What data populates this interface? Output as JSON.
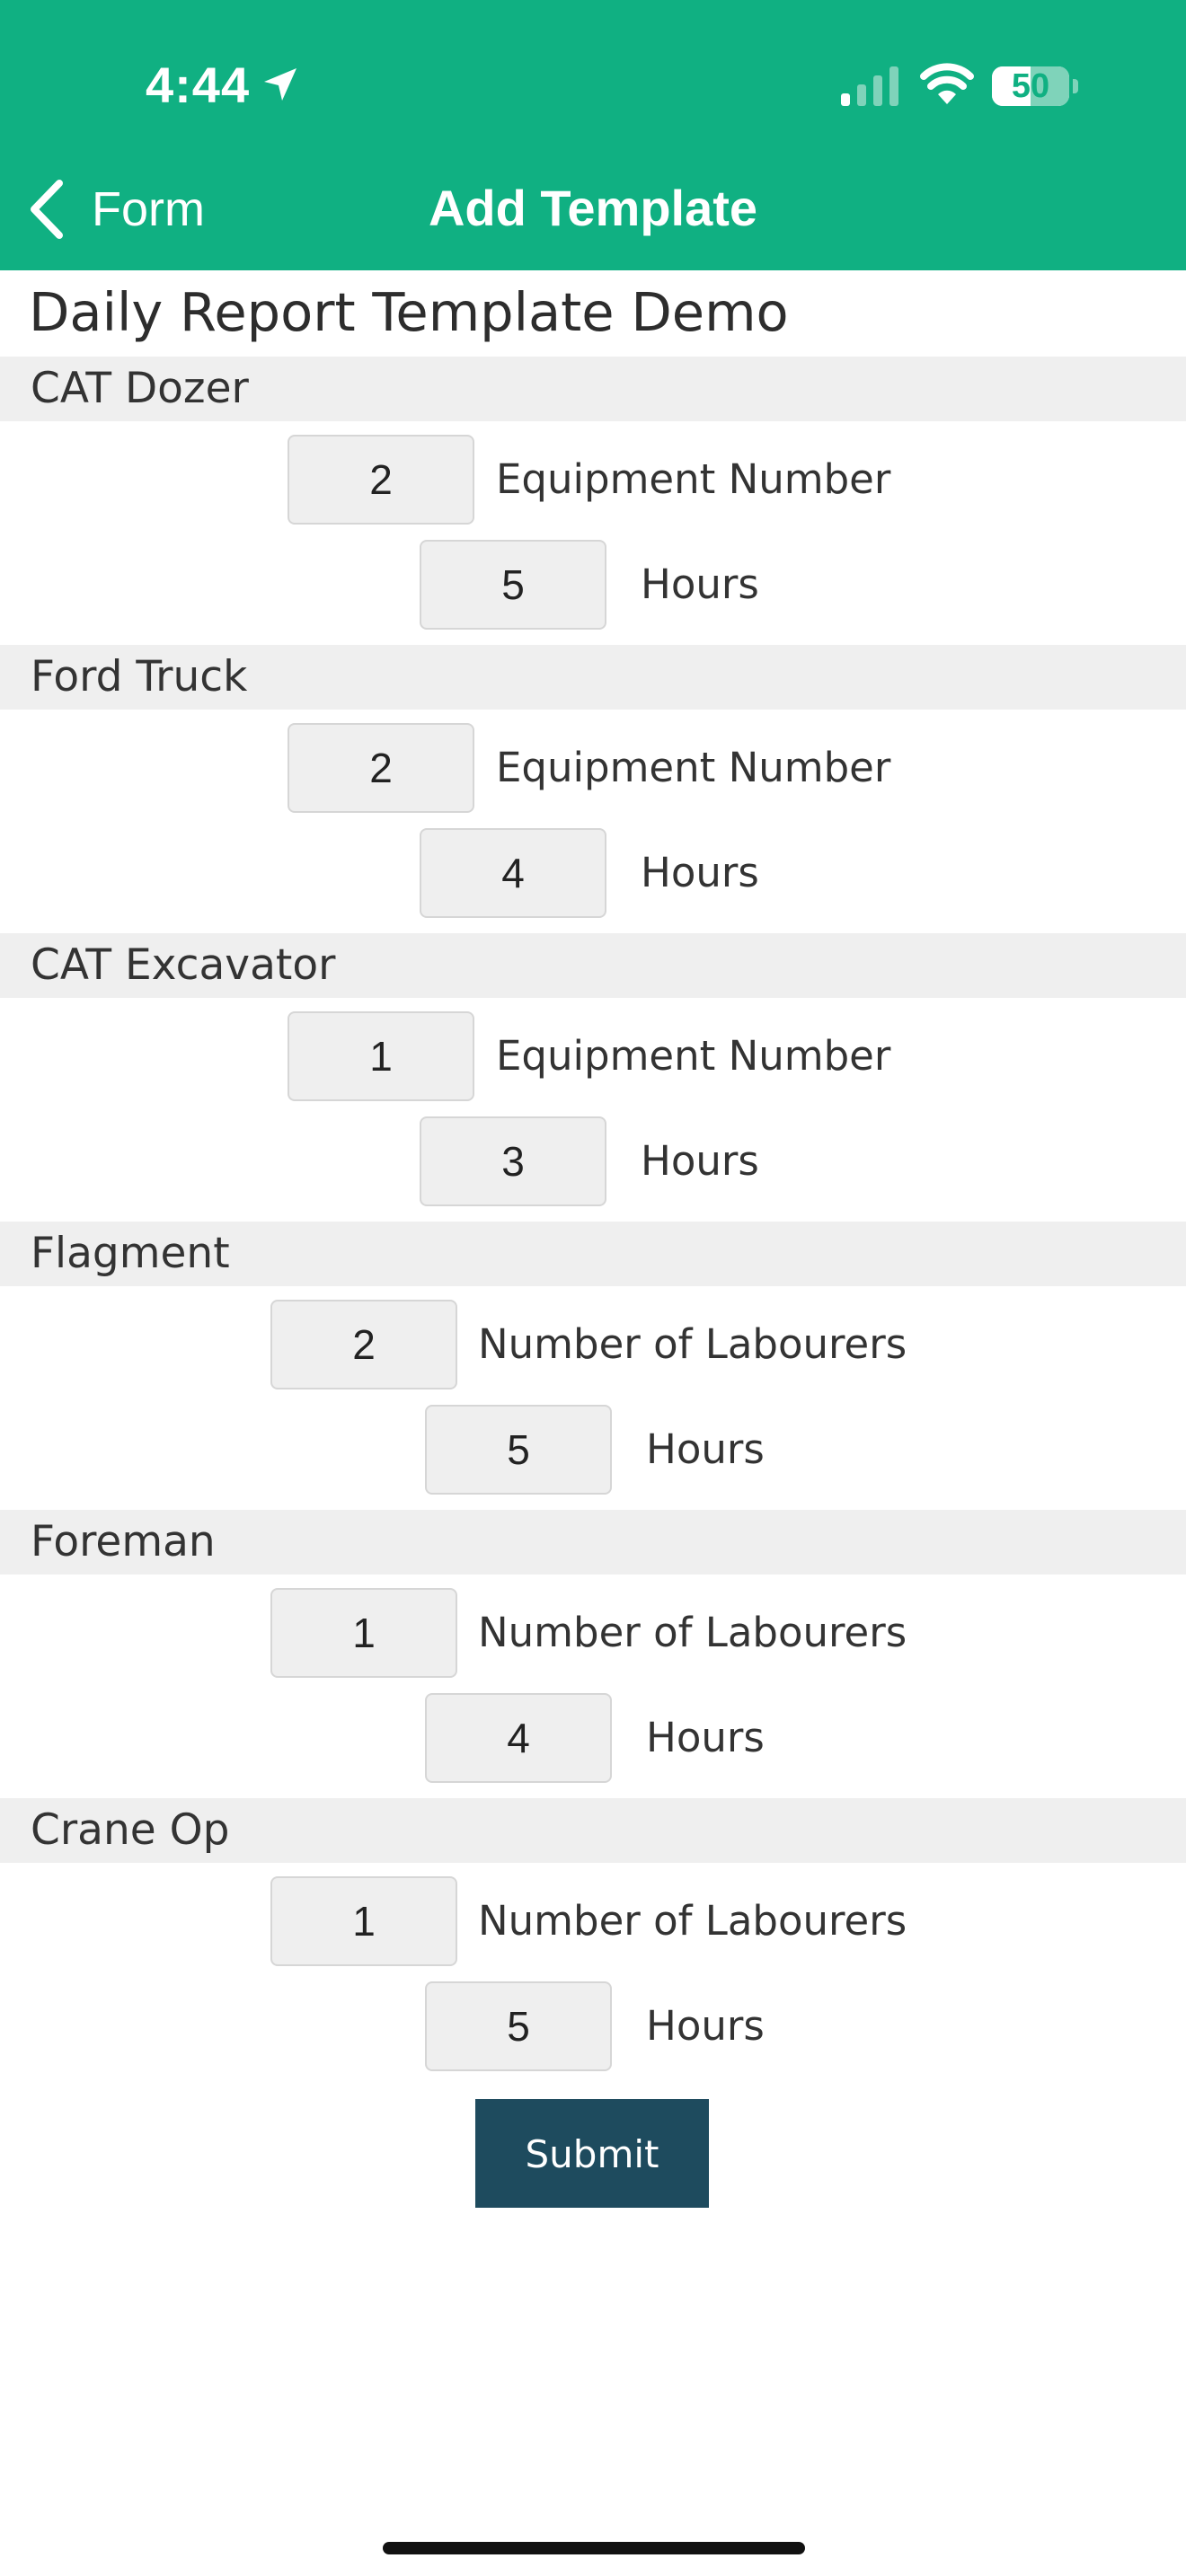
{
  "status_bar": {
    "time": "4:44",
    "battery_level": "50",
    "battery_fraction": 0.5,
    "icons": [
      "location-arrow-icon",
      "cellular-signal-icon",
      "wifi-icon",
      "battery-icon"
    ]
  },
  "nav": {
    "back_label": "Form",
    "title": "Add Template"
  },
  "form": {
    "title": "Daily Report Template Demo",
    "sections": [
      {
        "name": "CAT Dozer",
        "fields": [
          {
            "label": "Equipment Number",
            "value": "2"
          },
          {
            "label": "Hours",
            "value": "5"
          }
        ]
      },
      {
        "name": "Ford Truck",
        "fields": [
          {
            "label": "Equipment Number",
            "value": "2"
          },
          {
            "label": "Hours",
            "value": "4"
          }
        ]
      },
      {
        "name": "CAT Excavator",
        "fields": [
          {
            "label": "Equipment Number",
            "value": "1"
          },
          {
            "label": "Hours",
            "value": "3"
          }
        ]
      },
      {
        "name": "Flagment",
        "fields": [
          {
            "label": "Number of Labourers",
            "value": "2"
          },
          {
            "label": "Hours",
            "value": "5"
          }
        ]
      },
      {
        "name": "Foreman",
        "fields": [
          {
            "label": "Number of Labourers",
            "value": "1"
          },
          {
            "label": "Hours",
            "value": "4"
          }
        ]
      },
      {
        "name": "Crane Op",
        "fields": [
          {
            "label": "Number of Labourers",
            "value": "1"
          },
          {
            "label": "Hours",
            "value": "5"
          }
        ]
      }
    ],
    "submit_label": "Submit"
  },
  "colors": {
    "header": "#10b082",
    "section_band": "#efefef",
    "input_background": "#efefef",
    "submit_button": "#1e4b5e"
  }
}
